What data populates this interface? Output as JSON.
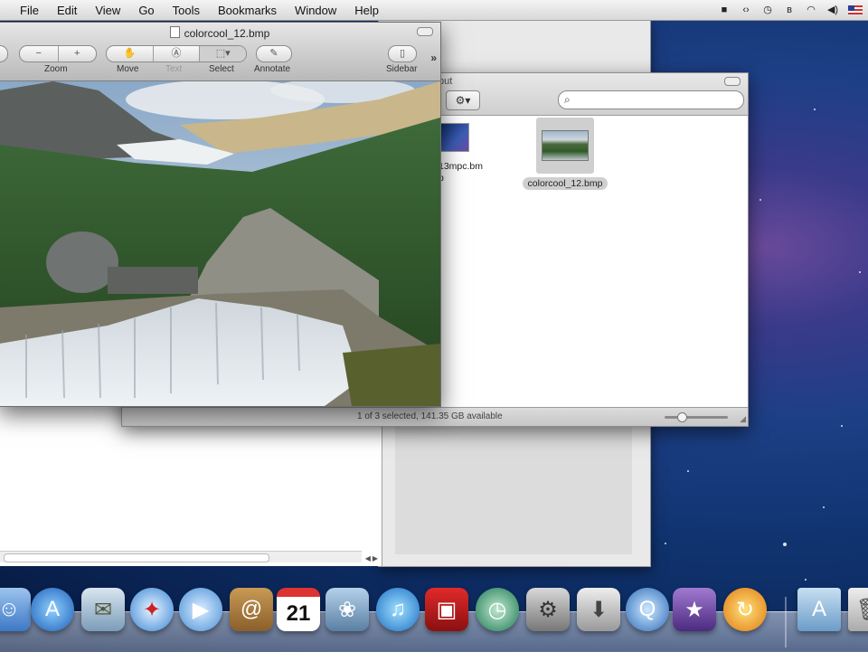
{
  "menubar": {
    "apple": "",
    "items": [
      "File",
      "Edit",
      "View",
      "Go",
      "Tools",
      "Bookmarks",
      "Window",
      "Help"
    ],
    "status_icons": [
      "screen-record-icon",
      "brackets-icon",
      "time-machine-icon",
      "bluetooth-icon",
      "wifi-icon",
      "volume-icon",
      "flag-us-icon"
    ]
  },
  "preview": {
    "title": "colorcool_12.bmp",
    "toolbar": {
      "zoom_label": "Zoom",
      "move_label": "Move",
      "text_label": "Text",
      "select_label": "Select",
      "annotate_label": "Annotate",
      "sidebar_label": "Sidebar",
      "overflow": "»"
    }
  },
  "finder": {
    "title": "put",
    "action_label": "⚙▾",
    "search": {
      "value": "",
      "placeholder": ""
    },
    "files": [
      {
        "name": "13mpc.bm\np"
      },
      {
        "name": "colorcool_12.bmp",
        "selected": true
      }
    ],
    "status_text": "1 of 3 selected, 141.35 GB available"
  },
  "dock": {
    "items": [
      "finder",
      "app-store",
      "preview",
      "safari",
      "facetime",
      "address-book",
      "calendar",
      "iphoto",
      "itunes",
      "photo-booth",
      "time-machine",
      "system-preferences",
      "installer",
      "quicktime",
      "imovie",
      "software-update",
      "applications-folder",
      "trash"
    ],
    "calendar_day": "21"
  }
}
